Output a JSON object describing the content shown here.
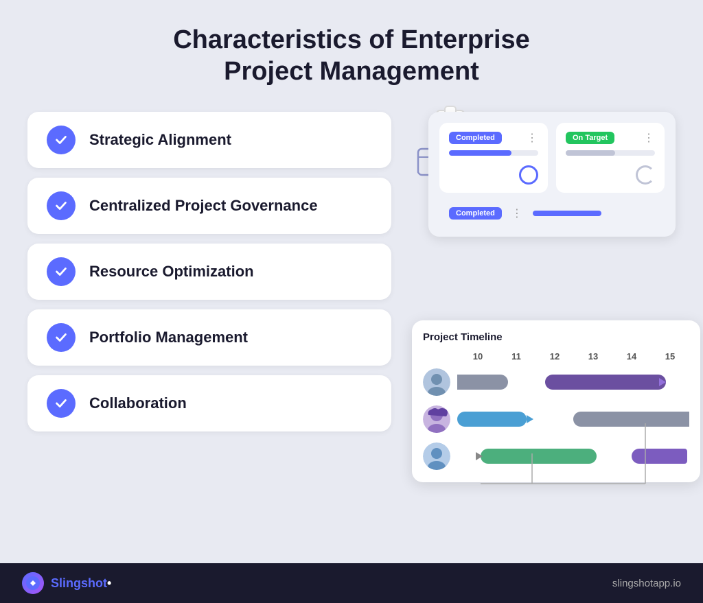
{
  "page": {
    "title_line1": "Characteristics of Enterprise",
    "title_line2": "Project Management",
    "background_color": "#e8eaf2"
  },
  "characteristics": [
    {
      "id": 1,
      "label": "Strategic Alignment"
    },
    {
      "id": 2,
      "label": "Centralized Project Governance"
    },
    {
      "id": 3,
      "label": "Resource Optimization"
    },
    {
      "id": 4,
      "label": "Portfolio Management"
    },
    {
      "id": 5,
      "label": "Collaboration"
    }
  ],
  "status_cards": {
    "card1": {
      "badge": "Completed",
      "badge_type": "completed"
    },
    "card2": {
      "badge": "On Target",
      "badge_type": "on-target"
    },
    "card3": {
      "badge": "Completed",
      "badge_type": "completed"
    }
  },
  "timeline": {
    "title": "Project Timeline",
    "columns": [
      "10",
      "11",
      "12",
      "13",
      "14",
      "15"
    ]
  },
  "footer": {
    "brand": "Slingshot",
    "url": "slingshotapp.io"
  }
}
